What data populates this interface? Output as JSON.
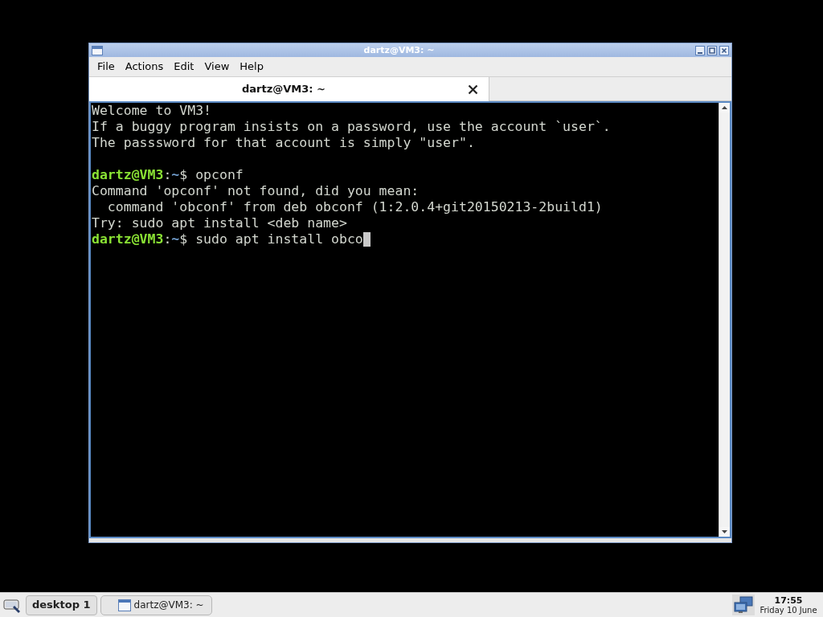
{
  "window": {
    "title": "dartz@VM3: ~"
  },
  "menu_bar": [
    "File",
    "Actions",
    "Edit",
    "View",
    "Help"
  ],
  "tabs": [
    {
      "label": "dartz@VM3: ~",
      "selected": true
    }
  ],
  "terminal": {
    "banner": [
      "Welcome to VM3!",
      "If a buggy program insists on a password, use the account `user`.",
      "The passsword for that account is simply \"user\"."
    ],
    "session": [
      {
        "segments": [
          {
            "kind": "user_host",
            "text": "dartz@VM3"
          },
          {
            "kind": "plain",
            "text": ":"
          },
          {
            "kind": "path",
            "text": "~"
          },
          {
            "kind": "plain",
            "text": "$ opconf"
          }
        ]
      },
      {
        "segments": [
          {
            "kind": "plain",
            "text": "Command 'opconf' not found, did you mean:"
          }
        ]
      },
      {
        "segments": [
          {
            "kind": "plain",
            "text": "  command 'obconf' from deb obconf (1:2.0.4+git20150213-2build1)"
          }
        ]
      },
      {
        "segments": [
          {
            "kind": "plain",
            "text": "Try: sudo apt install <deb name>"
          }
        ]
      },
      {
        "segments": [
          {
            "kind": "user_host",
            "text": "dartz@VM3"
          },
          {
            "kind": "plain",
            "text": ":"
          },
          {
            "kind": "path",
            "text": "~"
          },
          {
            "kind": "plain",
            "text": "$ sudo apt install obco"
          }
        ]
      }
    ],
    "cursor_visible": true
  },
  "taskbar": {
    "workspace": "desktop 1",
    "tasks": [
      {
        "label": "dartz@VM3: ~"
      }
    ],
    "clock": {
      "time": "17:55",
      "date": "Friday 10 June"
    }
  }
}
